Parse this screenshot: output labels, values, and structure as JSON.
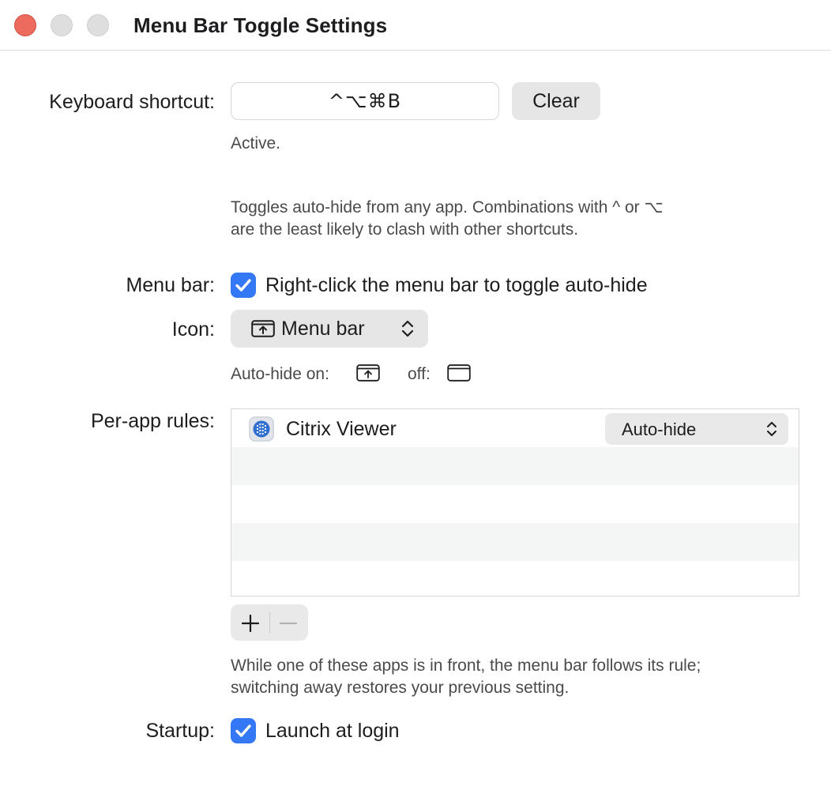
{
  "window": {
    "title": "Menu Bar Toggle Settings"
  },
  "shortcut": {
    "label": "Keyboard shortcut:",
    "value": "^⌥⌘B",
    "clear_label": "Clear",
    "status": "Active.",
    "help_line1": "Toggles auto-hide from any app. Combinations with ^ or ⌥",
    "help_line2": "are the least likely to clash with other shortcuts."
  },
  "menubar": {
    "label": "Menu bar:",
    "checkbox_label": "Right-click the menu bar to toggle auto-hide",
    "checked": true
  },
  "icon": {
    "label": "Icon:",
    "selected": "Menu bar",
    "legend_on": "Auto-hide on:",
    "legend_off": "off:"
  },
  "rules": {
    "label": "Per-app rules:",
    "rows": [
      {
        "app": "Citrix Viewer",
        "rule": "Auto-hide"
      }
    ],
    "help_line1": "While one of these apps is in front, the menu bar follows its rule;",
    "help_line2": "switching away restores your previous setting."
  },
  "startup": {
    "label": "Startup:",
    "checkbox_label": "Launch at login",
    "checked": true
  },
  "colors": {
    "accent": "#3478f6",
    "close": "#ed6a5e"
  }
}
